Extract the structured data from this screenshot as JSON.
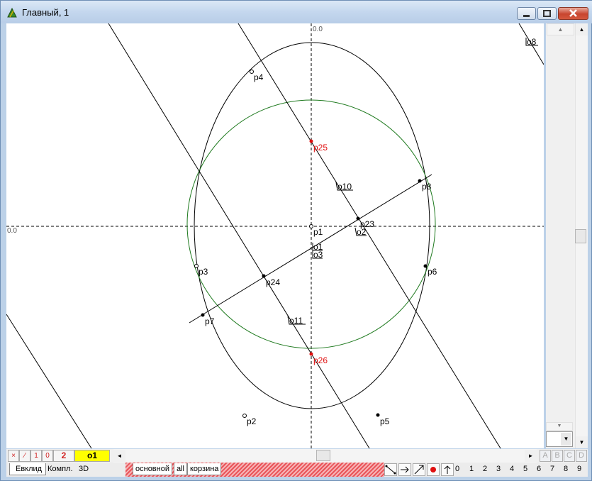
{
  "window": {
    "title": "Главный, 1"
  },
  "canvas": {
    "axis_label_top": "0.0",
    "axis_label_left": "0.0",
    "points": [
      {
        "name": "p1"
      },
      {
        "name": "p2"
      },
      {
        "name": "p3"
      },
      {
        "name": "p4"
      },
      {
        "name": "p5"
      },
      {
        "name": "p6"
      },
      {
        "name": "p7"
      },
      {
        "name": "p8"
      },
      {
        "name": "p23"
      },
      {
        "name": "p24"
      },
      {
        "name": "p25"
      },
      {
        "name": "p26"
      }
    ],
    "objects": [
      "o1",
      "o2",
      "o3",
      "o8",
      "o10",
      "o11"
    ]
  },
  "toolbar": {
    "cells": [
      "×",
      "⁄",
      "1",
      "0",
      "2"
    ],
    "active_object": "o1",
    "active_color": "#ffff00",
    "scroll_left_arrow": "◄",
    "scroll_right_arrow": "►",
    "letters": [
      "A",
      "B",
      "C",
      "D"
    ]
  },
  "tabs": {
    "left": [
      "Евклид",
      "Компл.",
      "3D"
    ],
    "layers": [
      "основной",
      "all",
      "корзина"
    ]
  },
  "digits": [
    "0",
    "1",
    "2",
    "3",
    "4",
    "5",
    "6",
    "7",
    "8",
    "9"
  ],
  "colors": {
    "circle": "#1f7a1f",
    "red_point": "#e01010",
    "curve": "#000000"
  }
}
